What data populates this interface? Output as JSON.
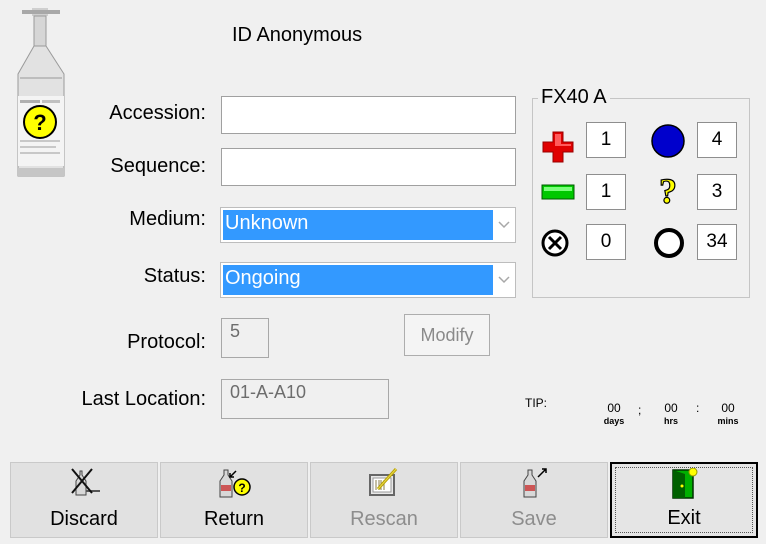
{
  "header": {
    "title": "ID Anonymous"
  },
  "form": {
    "accession": {
      "label": "Accession:",
      "value": ""
    },
    "sequence": {
      "label": "Sequence:",
      "value": ""
    },
    "medium": {
      "label": "Medium:",
      "value": "Unknown"
    },
    "status": {
      "label": "Status:",
      "value": "Ongoing"
    },
    "protocol": {
      "label": "Protocol:",
      "value": "5",
      "modify_label": "Modify"
    },
    "last_location": {
      "label": "Last Location:",
      "value": "01-A-A10"
    }
  },
  "instrument": {
    "title": "FX40 A",
    "counts": {
      "positive": "1",
      "negative": "4",
      "blank": "1",
      "unknown": "3",
      "error": "0",
      "empty": "34"
    },
    "colors": {
      "positive": "#e00000",
      "negative": "#0000cc",
      "blank": "#00c000",
      "unknown": "#ffff00"
    }
  },
  "tip": {
    "label": "TIP:",
    "days": "00",
    "hrs": "00",
    "mins": "00",
    "sep1": ";",
    "sep2": ":",
    "days_unit": "days",
    "hrs_unit": "hrs",
    "mins_unit": "mins"
  },
  "toolbar": {
    "discard": "Discard",
    "return": "Return",
    "rescan": "Rescan",
    "save": "Save",
    "exit": "Exit"
  }
}
